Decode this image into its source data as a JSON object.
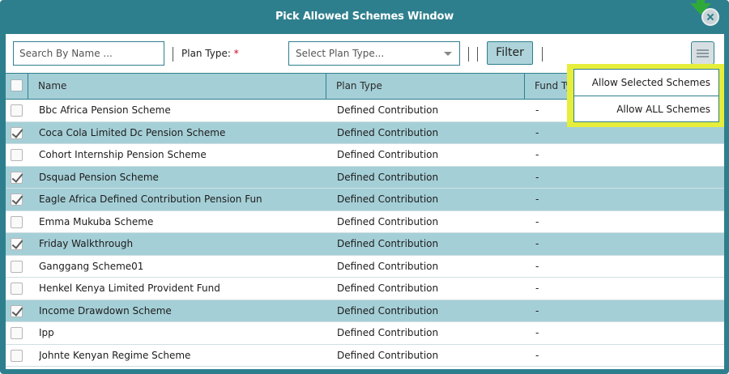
{
  "window": {
    "title": "Pick Allowed Schemes Window"
  },
  "toolbar": {
    "search_placeholder": "Search By Name ...",
    "plan_type_label": "Plan Type:",
    "required_marker": "*",
    "plan_type_placeholder": "Select Plan Type...",
    "filter_label": "Filter"
  },
  "table": {
    "columns": [
      "Name",
      "Plan Type",
      "Fund Type"
    ],
    "rows": [
      {
        "name": "Bbc Africa Pension Scheme",
        "plan_type": "Defined Contribution",
        "fund_type": "-",
        "checked": false
      },
      {
        "name": "Coca Cola Limited Dc Pension Scheme",
        "plan_type": "Defined Contribution",
        "fund_type": "-",
        "checked": true
      },
      {
        "name": "Cohort Internship Pension Scheme",
        "plan_type": "Defined Contribution",
        "fund_type": "-",
        "checked": false
      },
      {
        "name": "Dsquad Pension Scheme",
        "plan_type": "Defined Contribution",
        "fund_type": "-",
        "checked": true
      },
      {
        "name": "Eagle Africa Defined Contribution Pension Fun",
        "plan_type": "Defined Contribution",
        "fund_type": "-",
        "checked": true
      },
      {
        "name": "Emma Mukuba Scheme",
        "plan_type": "Defined Contribution",
        "fund_type": "-",
        "checked": false
      },
      {
        "name": "Friday Walkthrough",
        "plan_type": "Defined Contribution",
        "fund_type": "-",
        "checked": true
      },
      {
        "name": "Ganggang Scheme01",
        "plan_type": "Defined Contribution",
        "fund_type": "-",
        "checked": false
      },
      {
        "name": "Henkel Kenya Limited Provident Fund",
        "plan_type": "Defined Contribution",
        "fund_type": "-",
        "checked": false
      },
      {
        "name": "Income Drawdown Scheme",
        "plan_type": "Defined Contribution",
        "fund_type": "-",
        "checked": true
      },
      {
        "name": "Ipp",
        "plan_type": "Defined Contribution",
        "fund_type": "-",
        "checked": false
      },
      {
        "name": "Johnte Kenyan Regime Scheme",
        "plan_type": "Defined Contribution",
        "fund_type": "-",
        "checked": false
      }
    ]
  },
  "menu": {
    "items": [
      "Allow Selected Schemes",
      "Allow ALL Schemes"
    ]
  },
  "colors": {
    "frame": "#2e7f8e",
    "selected_row": "#a5cfd7",
    "highlight": "#e6ee3b",
    "arrow": "#2faa3a",
    "required": "#d0021b"
  }
}
